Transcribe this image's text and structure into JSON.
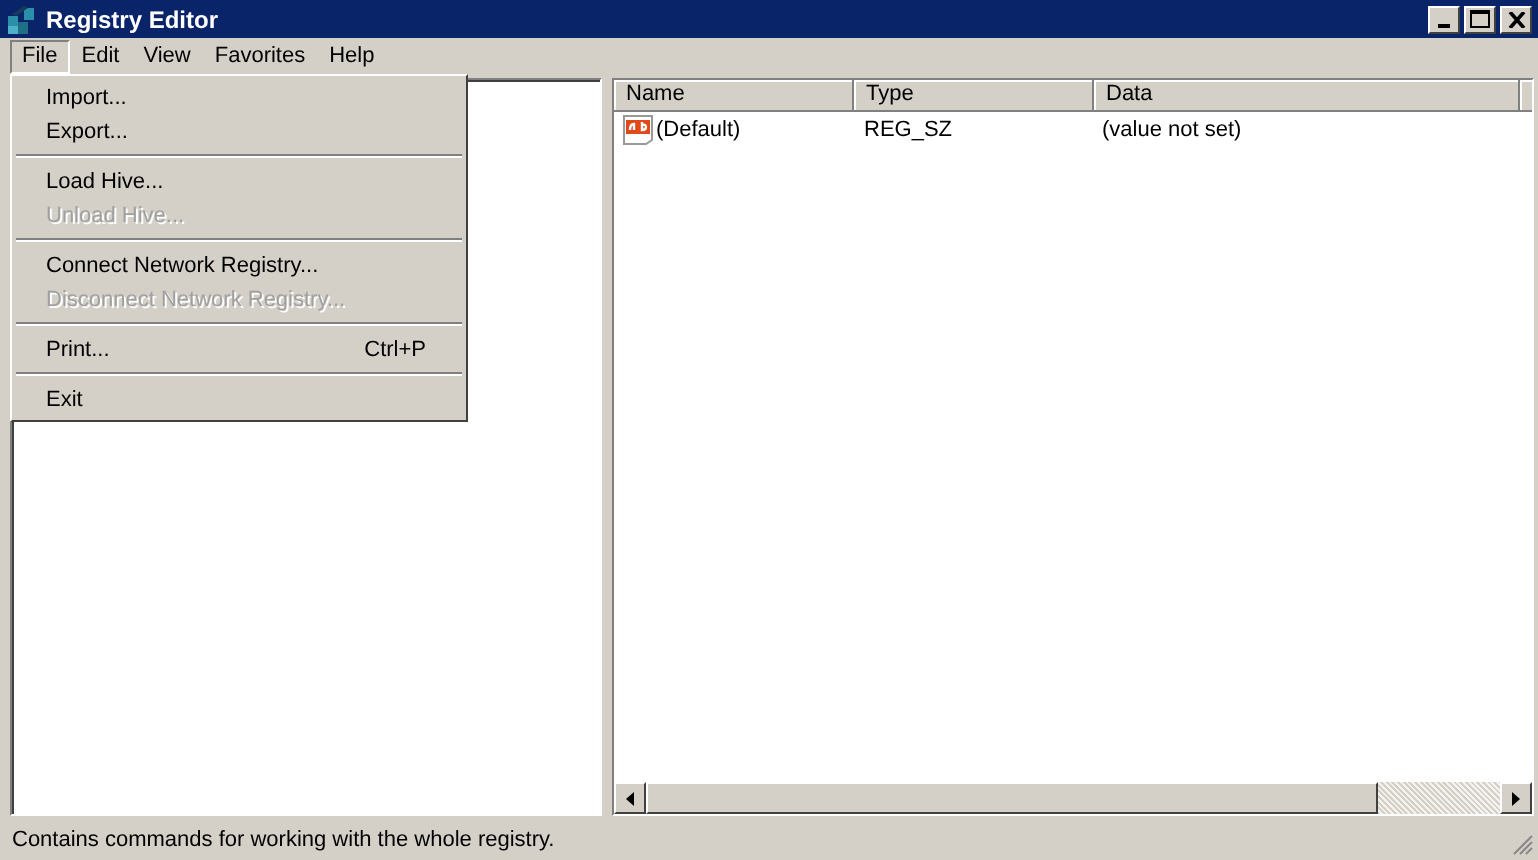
{
  "window": {
    "title": "Registry Editor"
  },
  "menu_bar": [
    {
      "label": "File",
      "selected": true
    },
    {
      "label": "Edit",
      "selected": false
    },
    {
      "label": "View",
      "selected": false
    },
    {
      "label": "Favorites",
      "selected": false
    },
    {
      "label": "Help",
      "selected": false
    }
  ],
  "file_menu": {
    "groups": [
      [
        {
          "label": "Import...",
          "disabled": false
        },
        {
          "label": "Export...",
          "disabled": false
        }
      ],
      [
        {
          "label": "Load Hive...",
          "disabled": false
        },
        {
          "label": "Unload Hive...",
          "disabled": true
        }
      ],
      [
        {
          "label": "Connect Network Registry...",
          "disabled": false
        },
        {
          "label": "Disconnect Network Registry...",
          "disabled": true
        }
      ],
      [
        {
          "label": "Print...",
          "shortcut": "Ctrl+P",
          "disabled": false
        }
      ],
      [
        {
          "label": "Exit",
          "disabled": false
        }
      ]
    ]
  },
  "values_table": {
    "columns": [
      "Name",
      "Type",
      "Data"
    ],
    "rows": [
      {
        "name": "(Default)",
        "type": "REG_SZ",
        "data": "(value not set)"
      }
    ]
  },
  "status_bar": "Contains commands for working with the whole registry."
}
